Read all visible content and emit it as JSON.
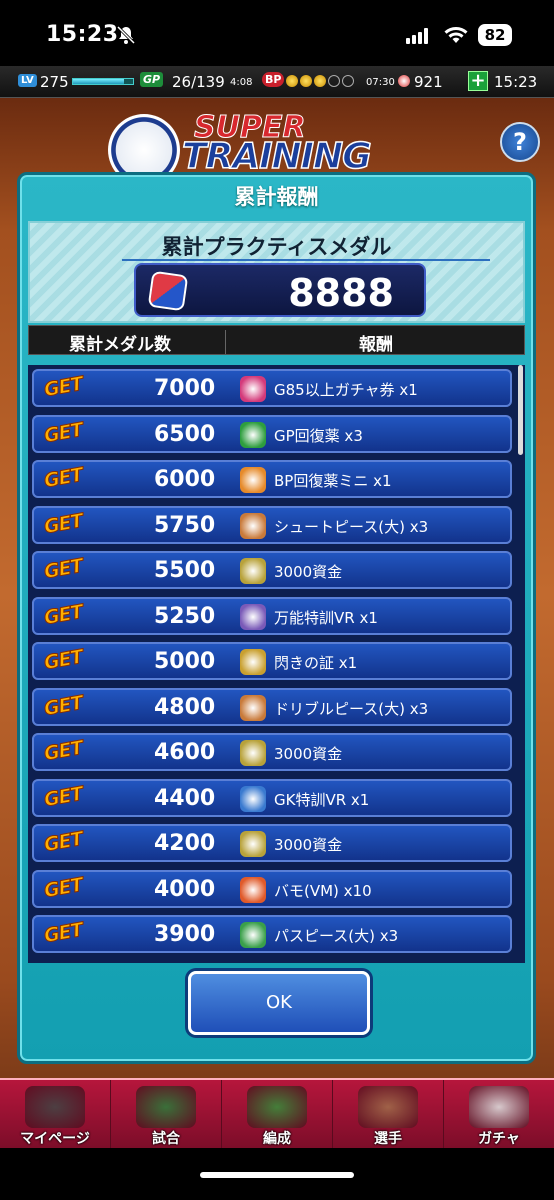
{
  "status_bar": {
    "time": "15:23",
    "battery": "82"
  },
  "hud": {
    "lv_label": "LV",
    "level": "275",
    "gp_label": "GP",
    "gp": "26/139",
    "gp_timer": "4:08",
    "bp_label": "BP",
    "bp_timer": "07:30",
    "coins": "921",
    "clock": "15:23"
  },
  "scene": {
    "logo_super": "SUPER",
    "logo_training": "TRAINING CAMP",
    "help": "?"
  },
  "dialog": {
    "title": "累計報酬",
    "medal_label": "累計プラクティスメダル",
    "medal_value": "8888",
    "col_medals": "累計メダル数",
    "col_reward": "報酬",
    "ok_label": "OK",
    "rows": [
      {
        "status": "GET",
        "medals": "7000",
        "reward": "G85以上ガチャ券 x1"
      },
      {
        "status": "GET",
        "medals": "6500",
        "reward": "GP回復薬 x3"
      },
      {
        "status": "GET",
        "medals": "6000",
        "reward": "BP回復薬ミニ x1"
      },
      {
        "status": "GET",
        "medals": "5750",
        "reward": "シュートピース(大) x3"
      },
      {
        "status": "GET",
        "medals": "5500",
        "reward": "3000資金"
      },
      {
        "status": "GET",
        "medals": "5250",
        "reward": "万能特訓VR x1"
      },
      {
        "status": "GET",
        "medals": "5000",
        "reward": "閃きの証 x1"
      },
      {
        "status": "GET",
        "medals": "4800",
        "reward": "ドリブルピース(大) x3"
      },
      {
        "status": "GET",
        "medals": "4600",
        "reward": "3000資金"
      },
      {
        "status": "GET",
        "medals": "4400",
        "reward": "GK特訓VR x1"
      },
      {
        "status": "GET",
        "medals": "4200",
        "reward": "3000資金"
      },
      {
        "status": "GET",
        "medals": "4000",
        "reward": "バモ(VM) x10"
      },
      {
        "status": "GET",
        "medals": "3900",
        "reward": "パスピース(大) x3"
      }
    ]
  },
  "nav": [
    {
      "label": "マイページ"
    },
    {
      "label": "試合"
    },
    {
      "label": "編成"
    },
    {
      "label": "選手"
    },
    {
      "label": "ガチャ"
    }
  ],
  "colors": {
    "accent": "#139fb1",
    "row": "#12338c",
    "nav": "#b6163c"
  }
}
